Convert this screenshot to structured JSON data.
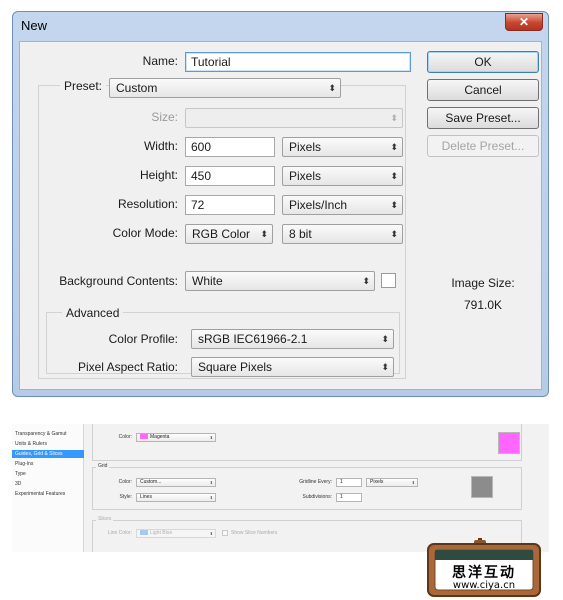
{
  "dialog": {
    "title": "New",
    "close_glyph": "✕",
    "name_label": "Name:",
    "name_value": "Tutorial",
    "preset_label": "Preset:",
    "preset_value": "Custom",
    "size_label": "Size:",
    "size_value": "",
    "width_label": "Width:",
    "width_value": "600",
    "width_unit": "Pixels",
    "height_label": "Height:",
    "height_value": "450",
    "height_unit": "Pixels",
    "resolution_label": "Resolution:",
    "resolution_value": "72",
    "resolution_unit": "Pixels/Inch",
    "color_mode_label": "Color Mode:",
    "color_mode_value": "RGB Color",
    "bit_depth_value": "8 bit",
    "background_label": "Background Contents:",
    "background_value": "White",
    "background_color": "#ffffff",
    "advanced_legend": "Advanced",
    "color_profile_label": "Color Profile:",
    "color_profile_value": "sRGB IEC61966-2.1",
    "pixel_aspect_label": "Pixel Aspect Ratio:",
    "pixel_aspect_value": "Square Pixels",
    "buttons": {
      "ok": "OK",
      "cancel": "Cancel",
      "save_preset": "Save Preset...",
      "delete_preset": "Delete Preset..."
    },
    "image_size_label": "Image Size:",
    "image_size_value": "791.0K",
    "arrow_glyph": "⬍"
  },
  "preferences": {
    "sidebar": [
      {
        "label": "Transparency & Gamut",
        "active": false
      },
      {
        "label": "Units & Rulers",
        "active": false
      },
      {
        "label": "Guides, Grid & Slices",
        "active": true
      },
      {
        "label": "Plug-Ins",
        "active": false
      },
      {
        "label": "Type",
        "active": false
      },
      {
        "label": "3D",
        "active": false
      },
      {
        "label": "Experimental Features",
        "active": false
      }
    ],
    "guides": {
      "color_label": "Color:",
      "color_value": "Magenta",
      "color_swatch": "#ff66ff"
    },
    "grid": {
      "legend": "Grid",
      "color_label": "Color:",
      "color_value": "Custom...",
      "style_label": "Style:",
      "style_value": "Lines",
      "gridline_label": "Gridline Every:",
      "gridline_value": "1",
      "gridline_unit": "Pixels",
      "subdivisions_label": "Subdivisions:",
      "subdivisions_value": "1",
      "swatch_color": "#8c8c8c"
    },
    "slices": {
      "legend": "Slices",
      "line_color_label": "Line Color:",
      "line_color_value": "Light Blue",
      "line_color_swatch": "#a8c8f0",
      "show_numbers_label": "Show Slice Numbers"
    }
  },
  "watermark": {
    "chinese": "思洋互动",
    "url": "www.ciya.cn"
  }
}
